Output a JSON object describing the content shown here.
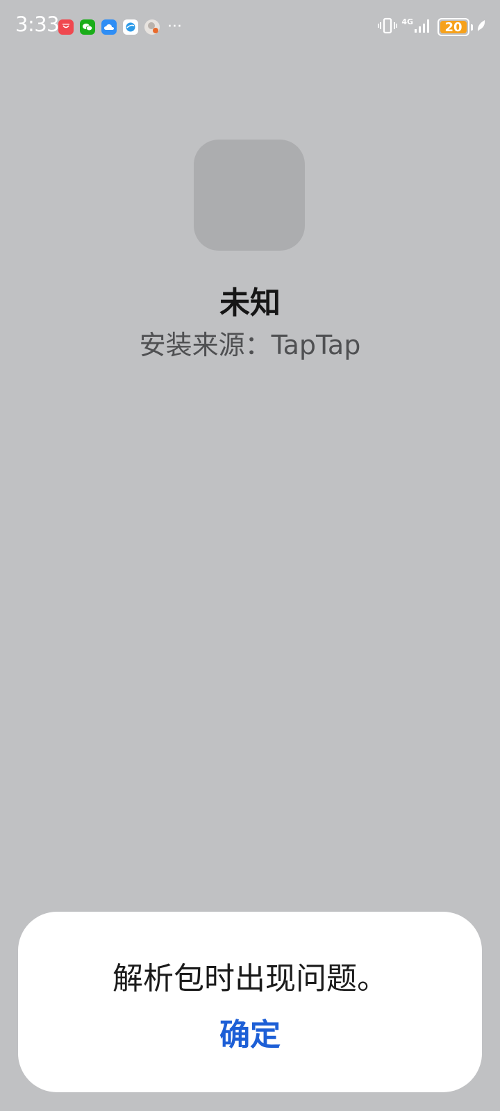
{
  "status_bar": {
    "time": "3:33",
    "network_type": "4G",
    "battery_level": "20",
    "more_indicator": "···",
    "notification_icons": [
      {
        "name": "huawei-appgallery-icon",
        "color": "#f0484f"
      },
      {
        "name": "wechat-icon",
        "color": "#1aad19"
      },
      {
        "name": "cloud-icon",
        "color": "#2f8ef5"
      },
      {
        "name": "browser-icon",
        "color": "#ffffff"
      },
      {
        "name": "avatar-app-icon",
        "color": "#e7e3df"
      }
    ],
    "colors": {
      "battery_fill": "#f6a11b",
      "icons": "#ffffff"
    }
  },
  "app_info": {
    "name": "未知",
    "install_source": "安装来源：TapTap"
  },
  "dialog": {
    "message": "解析包时出现问题。",
    "confirm_label": "确定",
    "accent_color": "#1d5fd6"
  }
}
